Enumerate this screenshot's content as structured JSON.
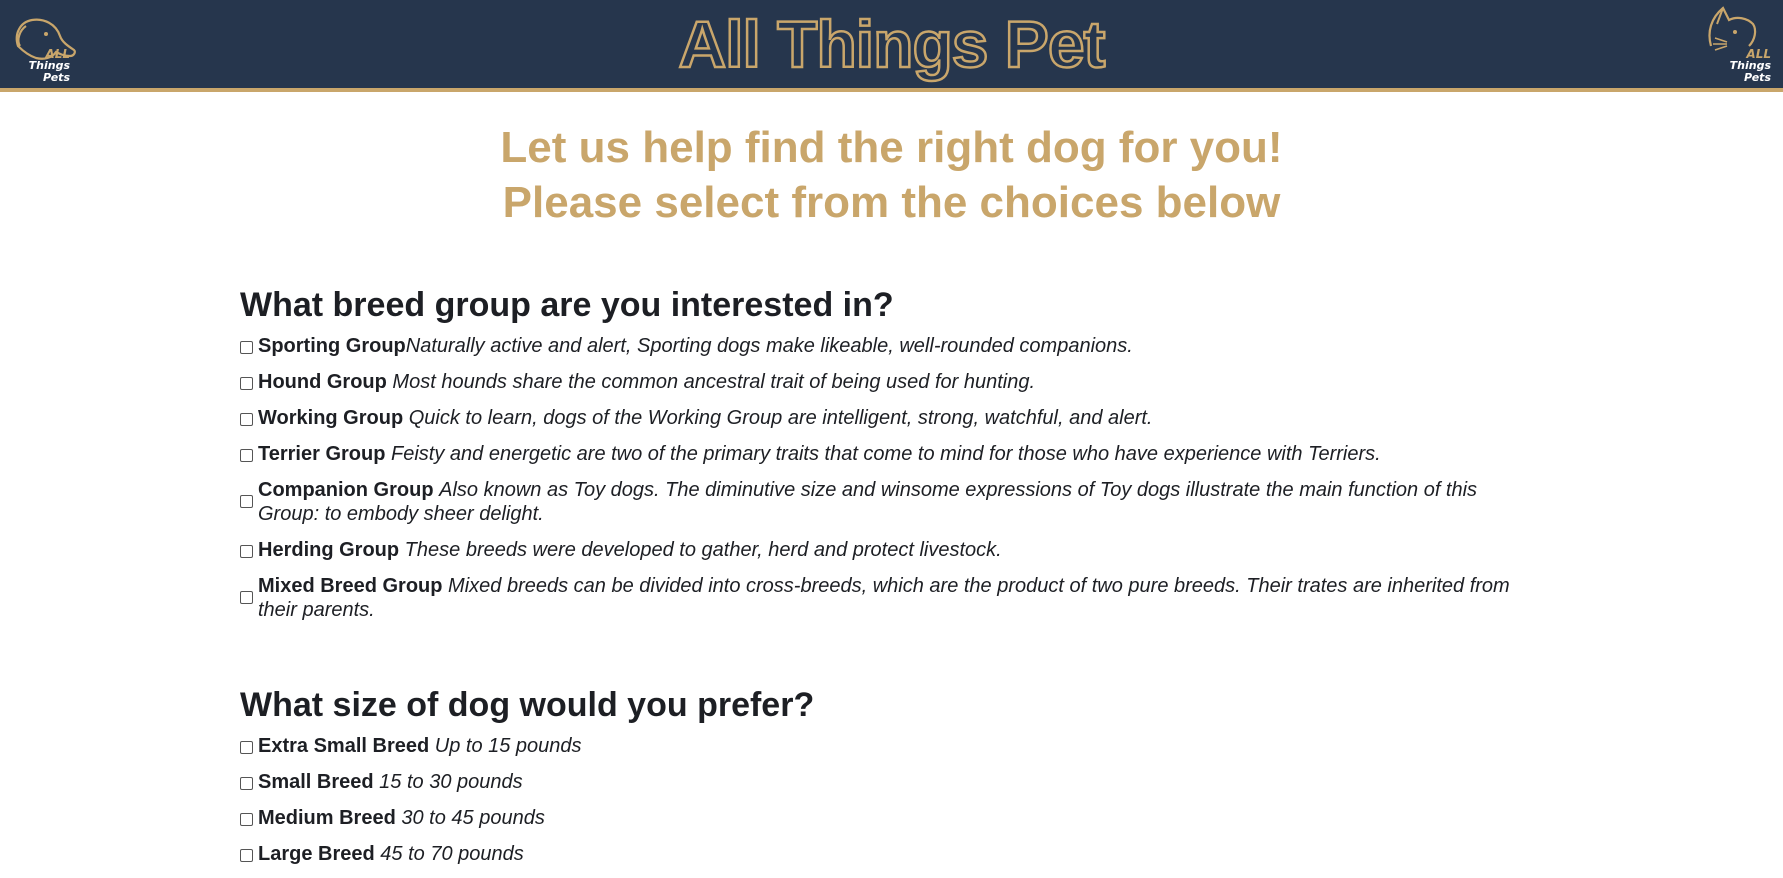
{
  "header": {
    "title": "All Things Pet",
    "logo_left": {
      "line1": "ALL",
      "line2": "Things Pets",
      "icon": "dog-head-icon"
    },
    "logo_right": {
      "line1": "ALL",
      "line2": "Things Pets",
      "icon": "cat-head-icon"
    }
  },
  "intro": {
    "line1": "Let us help find the right dog for you!",
    "line2": "Please select from the choices below"
  },
  "breed_group": {
    "heading": "What breed group are you interested in?",
    "options": [
      {
        "name": "Sporting Group",
        "desc": "Naturally active and alert, Sporting dogs make likeable, well-rounded companions."
      },
      {
        "name": "Hound Group",
        "desc": "Most hounds share the common ancestral trait of being used for hunting."
      },
      {
        "name": "Working Group",
        "desc": "Quick to learn, dogs of the Working Group are intelligent, strong, watchful, and alert."
      },
      {
        "name": "Terrier Group",
        "desc": "Feisty and energetic are two of the primary traits that come to mind for those who have experience with Terriers."
      },
      {
        "name": "Companion Group",
        "desc": "Also known as Toy dogs. The diminutive size and winsome expressions of Toy dogs illustrate the main function of this Group: to embody sheer delight."
      },
      {
        "name": "Herding Group",
        "desc": "These breeds were developed to gather, herd and protect livestock."
      },
      {
        "name": "Mixed Breed Group",
        "desc": "Mixed breeds can be divided into cross-breeds, which are the product of two pure breeds. Their trates are inherited from their parents."
      }
    ]
  },
  "dog_size": {
    "heading": "What size of dog would you prefer?",
    "options": [
      {
        "name": "Extra Small Breed",
        "desc": "Up to 15 pounds"
      },
      {
        "name": "Small Breed",
        "desc": "15 to 30 pounds"
      },
      {
        "name": "Medium Breed",
        "desc": "30 to 45 pounds"
      },
      {
        "name": "Large Breed",
        "desc": "45 to 70 pounds"
      }
    ]
  },
  "colors": {
    "navy": "#26364d",
    "gold": "#c9a66b",
    "text": "#1d1f24"
  }
}
